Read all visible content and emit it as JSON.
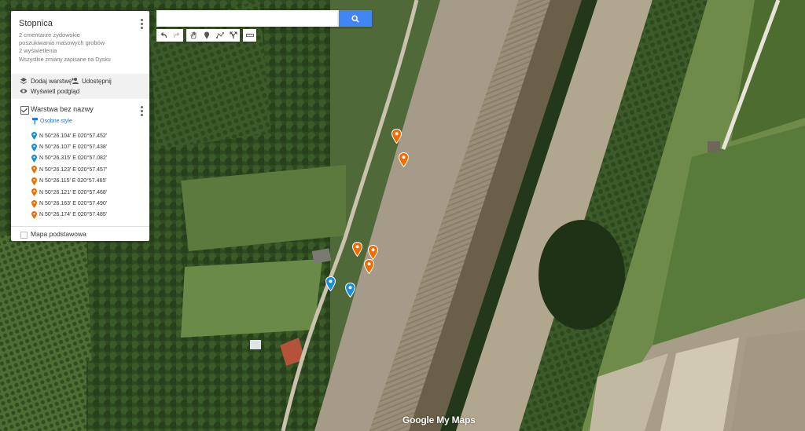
{
  "panel": {
    "title": "Stopnica",
    "description": "2 cmentarze żydowskie poszukiwania masowych grobów",
    "views": "2 wyświetlenia",
    "saved_status": "Wszystkie zmiany zapisane na Dysku",
    "actions": {
      "add_layer": "Dodaj warstwę",
      "share": "Udostępnij",
      "preview": "Wyświetl podgląd"
    },
    "layer": {
      "name": "Warstwa bez nazwy",
      "checked": true,
      "style_link": "Osobne style",
      "points": [
        {
          "label": "N 50°26.104' E 020°57.452'",
          "color": "#1a8ed6"
        },
        {
          "label": "N 50°26.107' E 020°57.438'",
          "color": "#1a8ed6"
        },
        {
          "label": "N 50°26.315' E 020°57.082'",
          "color": "#1a8ed6"
        },
        {
          "label": "N 50°26.123' E 020°57.457'",
          "color": "#ef6c00"
        },
        {
          "label": "N 50°26.115' E 020°57.465'",
          "color": "#ef6c00"
        },
        {
          "label": "N 50°26.121' E 020°57.468'",
          "color": "#ef6c00"
        },
        {
          "label": "N 50°26.163' E 020°57.490'",
          "color": "#ef6c00"
        },
        {
          "label": "N 50°26.174' E 020°57.485'",
          "color": "#ef6c00"
        }
      ]
    },
    "basemap_label": "Mapa podstawowa"
  },
  "search": {
    "value": "",
    "placeholder": ""
  },
  "toolbar": {
    "icons": [
      "undo-icon",
      "redo-icon",
      "hand-icon",
      "add-marker-icon",
      "draw-line-icon",
      "directions-icon",
      "ruler-icon"
    ]
  },
  "colors": {
    "accent": "#4285f4",
    "marker_blue": "#1a8ed6",
    "marker_orange": "#ef6c00"
  },
  "logo": "Google My Maps"
}
